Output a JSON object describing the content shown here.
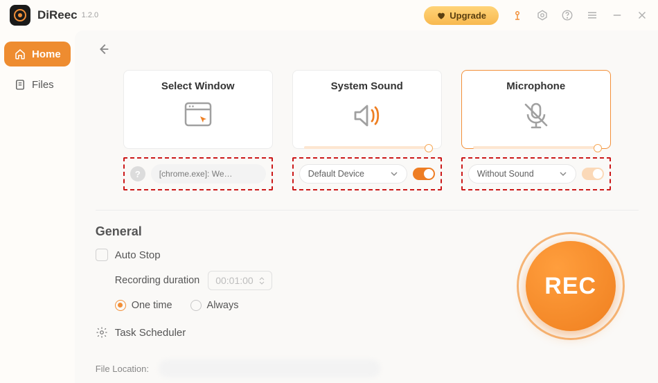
{
  "app": {
    "name": "DiReec",
    "version": "1.2.0"
  },
  "titlebar": {
    "upgrade": "Upgrade"
  },
  "sidebar": {
    "items": [
      {
        "label": "Home",
        "active": true
      },
      {
        "label": "Files",
        "active": false
      }
    ]
  },
  "cards": {
    "window": {
      "title": "Select Window",
      "value": "[chrome.exe]: We…"
    },
    "system_sound": {
      "title": "System Sound",
      "device": "Default Device",
      "enabled": true
    },
    "microphone": {
      "title": "Microphone",
      "device": "Without Sound",
      "enabled": false
    }
  },
  "general": {
    "heading": "General",
    "auto_stop": "Auto Stop",
    "duration_label": "Recording duration",
    "duration_value": "00:01:00",
    "one_time": "One time",
    "always": "Always",
    "task_scheduler": "Task Scheduler",
    "file_location_label": "File Location:"
  },
  "rec": {
    "label": "REC"
  }
}
